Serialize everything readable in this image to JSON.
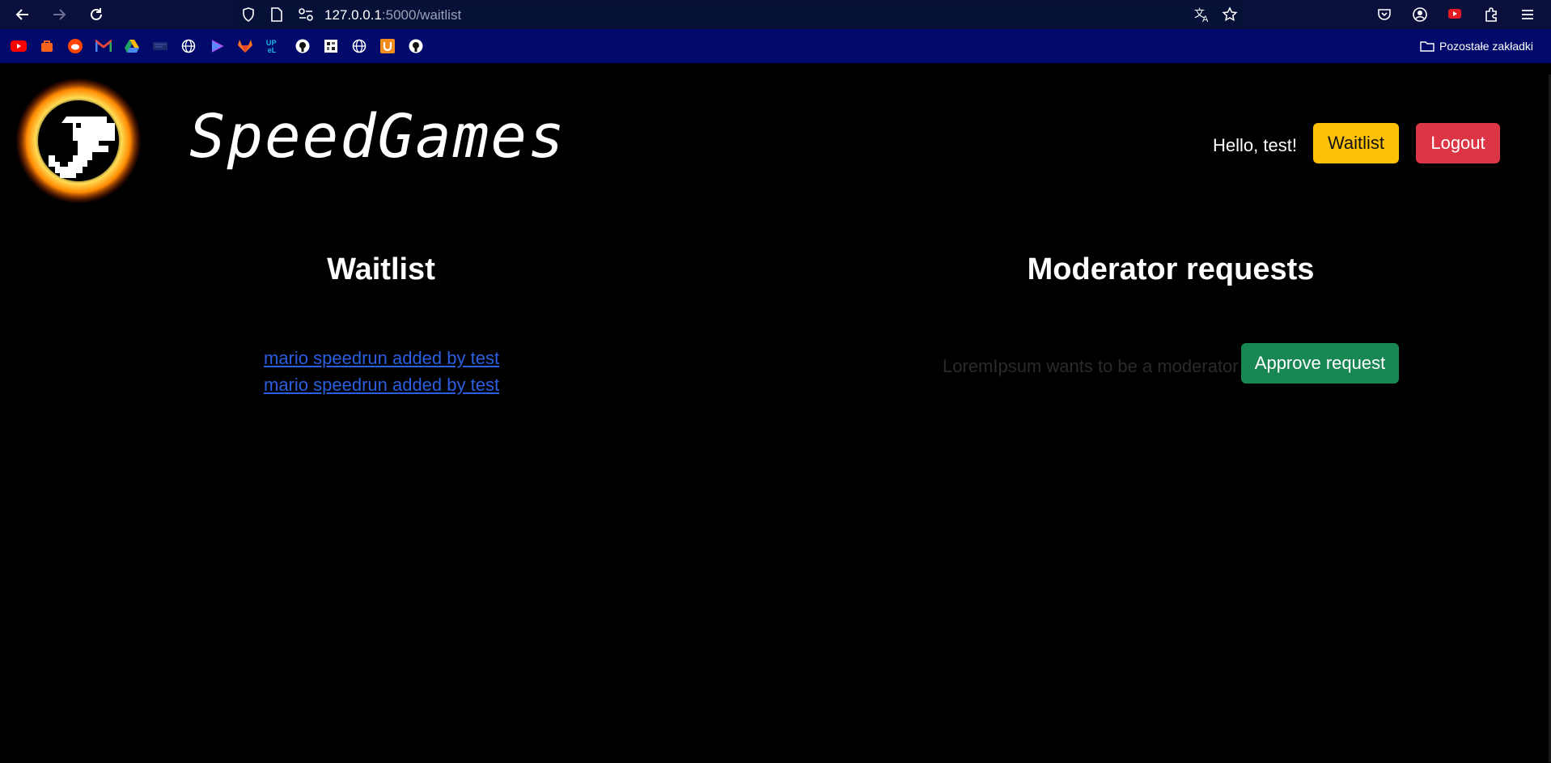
{
  "browser": {
    "url_host": "127.0.0.1",
    "url_path": ":5000/waitlist",
    "other_bookmarks_label": "Pozostałe zakładki",
    "bookmarks": [
      {
        "icon": "youtube-icon",
        "color": "#ff0000"
      },
      {
        "icon": "bag-icon",
        "color": "#f5631d"
      },
      {
        "icon": "reddit-icon",
        "color": "#ff4500"
      },
      {
        "icon": "gmail-icon",
        "color": "#ea4335"
      },
      {
        "icon": "drive-icon",
        "color": "#1fa463"
      },
      {
        "icon": "tab-icon",
        "color": "#1a2a6b"
      },
      {
        "icon": "globe-icon",
        "color": "#ffffff"
      },
      {
        "icon": "play-icon",
        "color": "#5b8cff"
      },
      {
        "icon": "gitlab-icon",
        "color": "#fc6d26"
      },
      {
        "icon": "upel-icon",
        "color": "#1fb0e6"
      },
      {
        "icon": "github-icon",
        "color": "#ffffff"
      },
      {
        "icon": "puzzle-icon",
        "color": "#ffffff"
      },
      {
        "icon": "globe-icon",
        "color": "#ffffff"
      },
      {
        "icon": "u-icon",
        "color": "#f28c1e"
      },
      {
        "icon": "github-icon",
        "color": "#ffffff"
      }
    ]
  },
  "header": {
    "brand": "SpeedGames",
    "greeting": "Hello, test!",
    "waitlist_label": "Waitlist",
    "logout_label": "Logout"
  },
  "waitlist": {
    "title": "Waitlist",
    "items": [
      "mario speedrun added by test",
      "mario speedrun added by test"
    ]
  },
  "moderator": {
    "title": "Moderator requests",
    "requests": [
      {
        "text": "LoremIpsum wants to be a moderator",
        "action": "Approve request"
      }
    ]
  },
  "colors": {
    "waitlist_button": "#ffc107",
    "logout_button": "#dc3545",
    "approve_button": "#198754",
    "link": "#2b5fe0"
  }
}
